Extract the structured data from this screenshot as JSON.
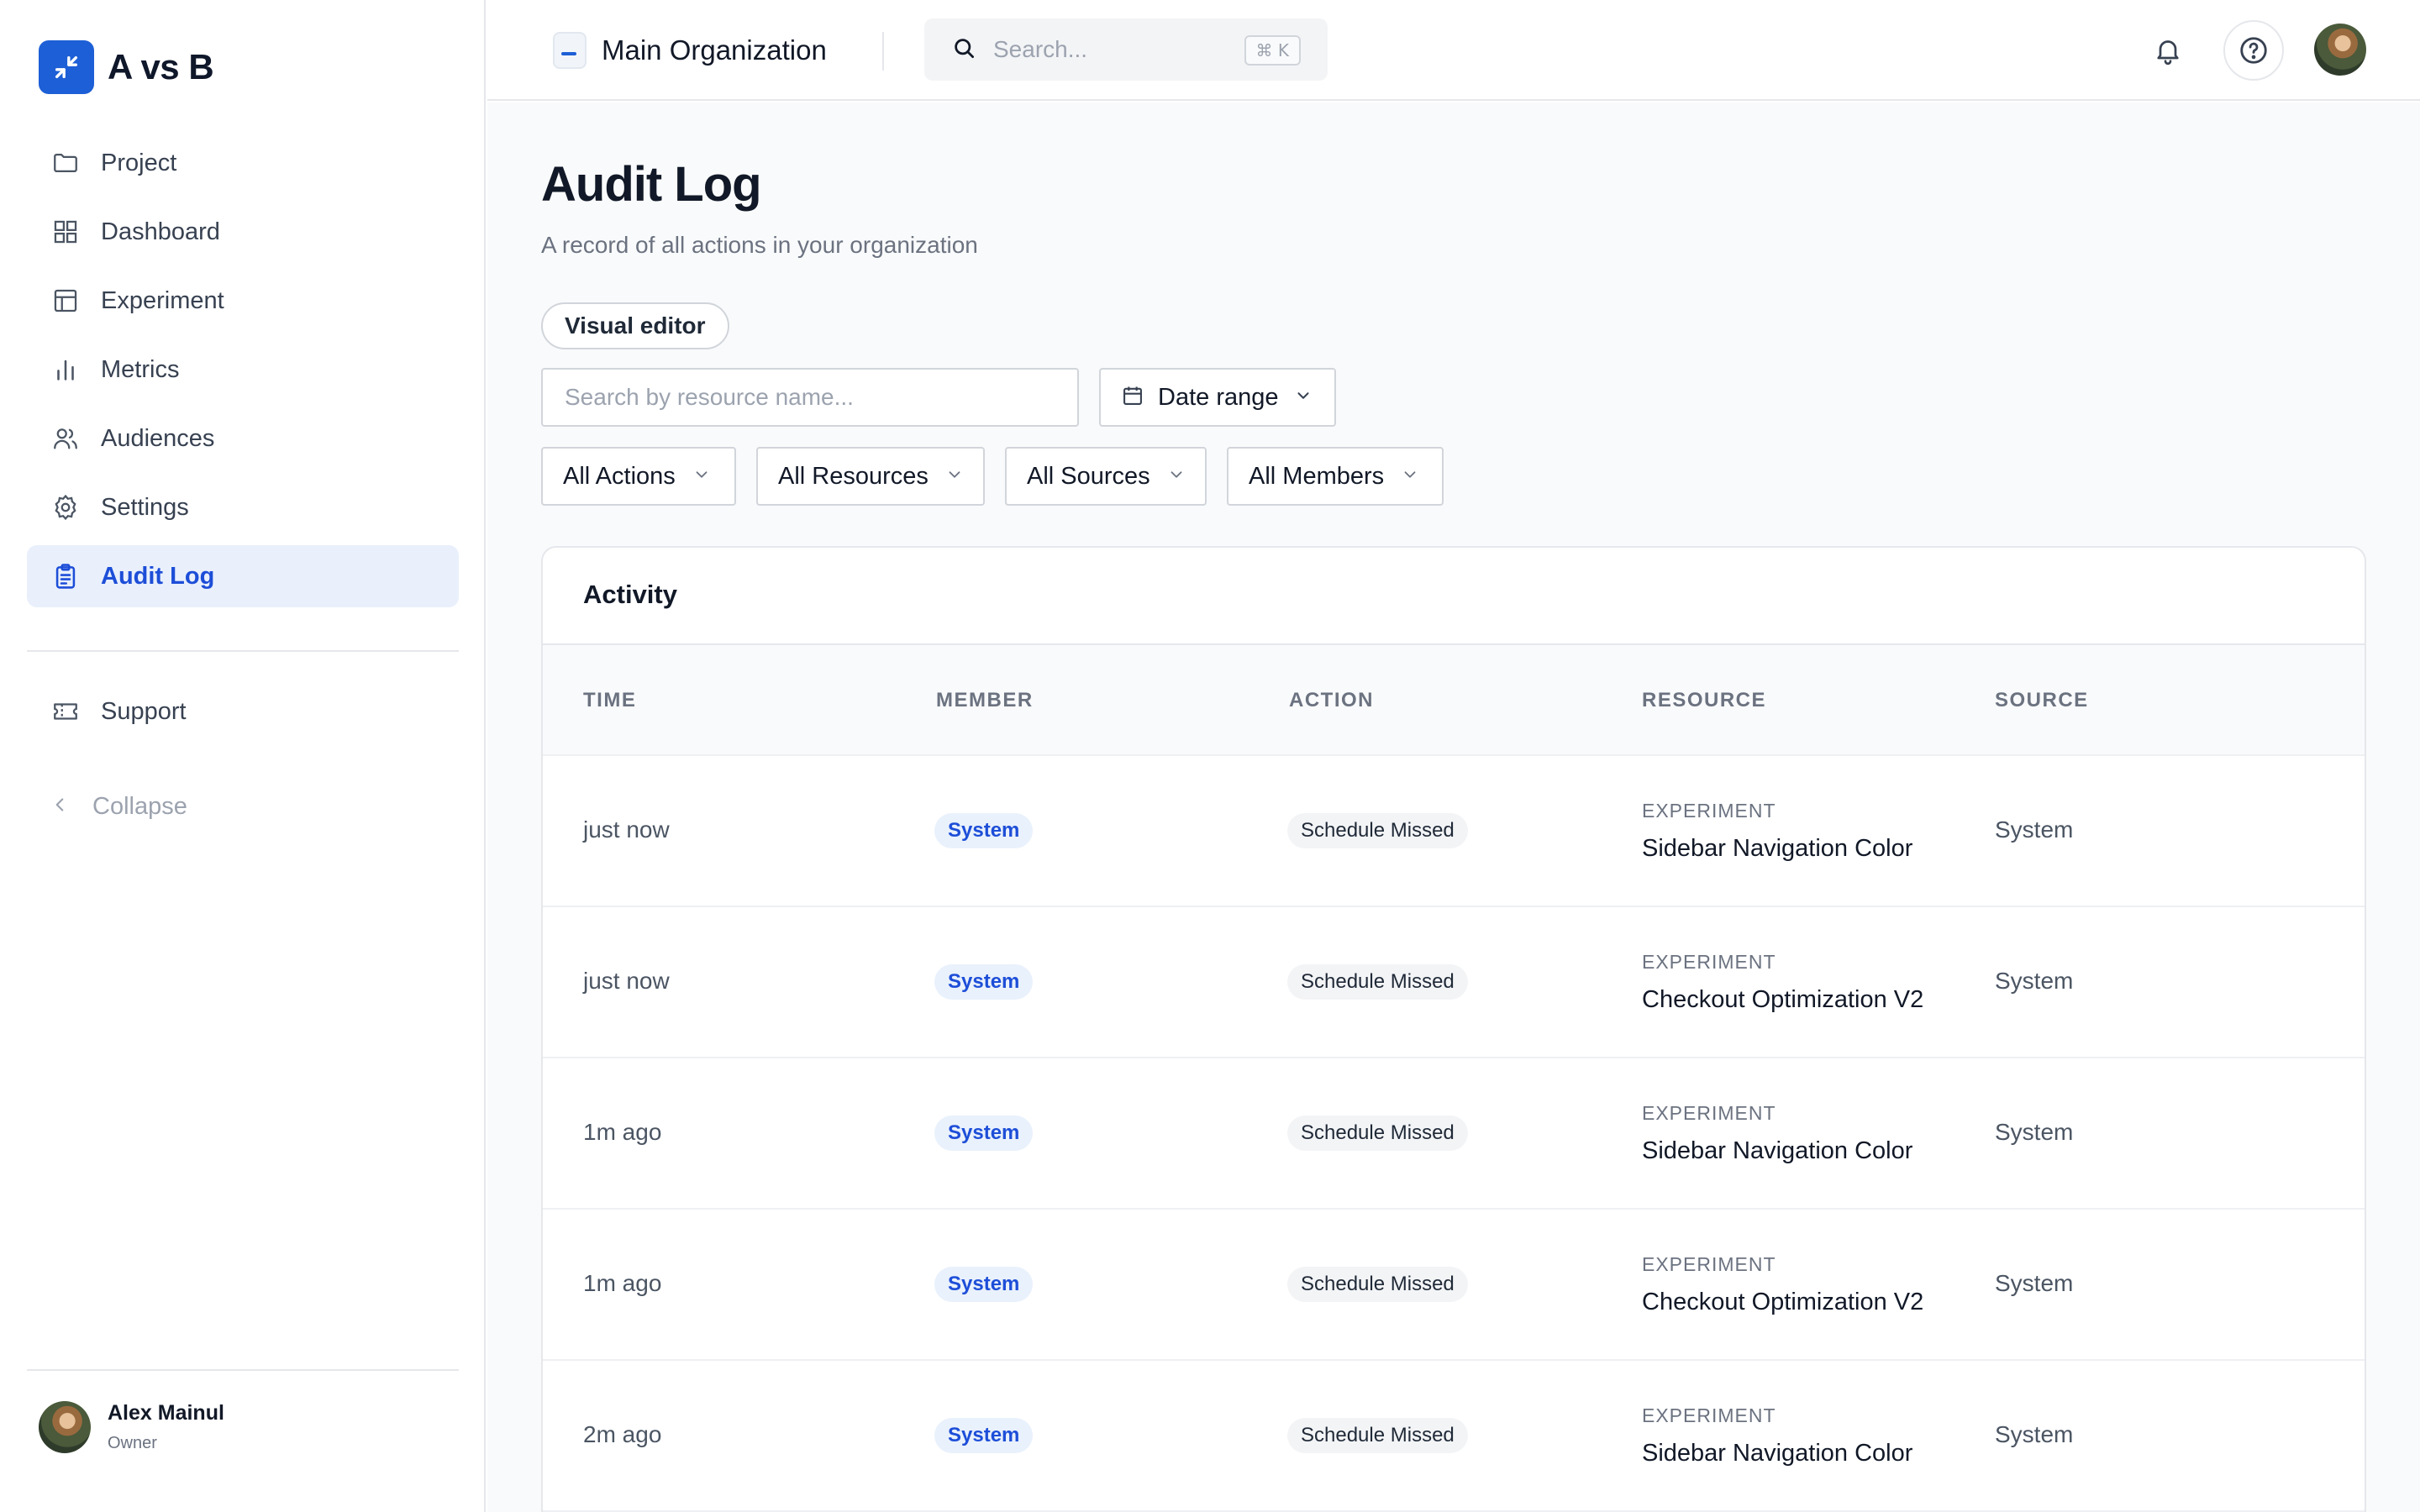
{
  "brand": {
    "name": "A vs B",
    "accent": "#1d5fd6"
  },
  "sidebar": {
    "items": [
      {
        "label": "Project",
        "icon": "folder-icon"
      },
      {
        "label": "Dashboard",
        "icon": "grid-icon"
      },
      {
        "label": "Experiment",
        "icon": "table-icon"
      },
      {
        "label": "Metrics",
        "icon": "bar-chart-icon"
      },
      {
        "label": "Audiences",
        "icon": "users-icon"
      },
      {
        "label": "Settings",
        "icon": "gear-icon"
      },
      {
        "label": "Audit Log",
        "icon": "clipboard-icon",
        "active": true
      }
    ],
    "support": {
      "label": "Support",
      "icon": "ticket-icon"
    },
    "collapse": {
      "label": "Collapse",
      "icon": "chevron-left-icon"
    },
    "user": {
      "name": "Alex Mainul",
      "role": "Owner"
    }
  },
  "topbar": {
    "org_name": "Main Organization",
    "search_placeholder": "Search...",
    "search_shortcut": "⌘ K"
  },
  "page": {
    "title": "Audit Log",
    "subtitle": "A record of all actions in your organization",
    "visual_editor_label": "Visual editor",
    "filters": {
      "resource_search_placeholder": "Search by resource name...",
      "date_range_label": "Date range",
      "actions": "All Actions",
      "resources": "All Resources",
      "sources": "All Sources",
      "members": "All Members"
    }
  },
  "activity": {
    "title": "Activity",
    "columns": [
      "TIME",
      "MEMBER",
      "ACTION",
      "RESOURCE",
      "SOURCE"
    ],
    "rows": [
      {
        "time": "just now",
        "member": "System",
        "action": "Schedule Missed",
        "resource_type": "EXPERIMENT",
        "resource_name": "Sidebar Navigation Color",
        "source": "System"
      },
      {
        "time": "just now",
        "member": "System",
        "action": "Schedule Missed",
        "resource_type": "EXPERIMENT",
        "resource_name": "Checkout Optimization V2",
        "source": "System"
      },
      {
        "time": "1m ago",
        "member": "System",
        "action": "Schedule Missed",
        "resource_type": "EXPERIMENT",
        "resource_name": "Sidebar Navigation Color",
        "source": "System"
      },
      {
        "time": "1m ago",
        "member": "System",
        "action": "Schedule Missed",
        "resource_type": "EXPERIMENT",
        "resource_name": "Checkout Optimization V2",
        "source": "System"
      },
      {
        "time": "2m ago",
        "member": "System",
        "action": "Schedule Missed",
        "resource_type": "EXPERIMENT",
        "resource_name": "Sidebar Navigation Color",
        "source": "System"
      }
    ]
  }
}
